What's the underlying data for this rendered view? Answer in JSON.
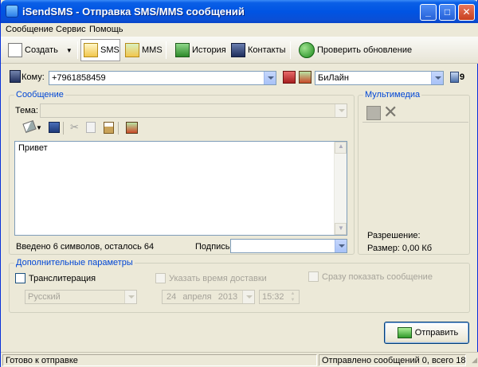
{
  "window": {
    "title": "iSendSMS - Отправка SMS/MMS сообщений"
  },
  "menu": {
    "items": [
      "Сообщение",
      "Сервис",
      "Помощь"
    ]
  },
  "toolbar": {
    "create": "Создать",
    "sms": "SMS",
    "mms": "MMS",
    "history": "История",
    "contacts": "Контакты",
    "update": "Проверить обновление"
  },
  "recipient": {
    "label": "Кому:",
    "value": "+7961858459",
    "operator": "БиЛайн",
    "count": "9"
  },
  "message": {
    "group_title": "Сообщение",
    "subject_label": "Тема:",
    "subject_value": "",
    "body": "Привет",
    "counter": "Введено 6 символов, осталось 64",
    "signature_label": "Подпись",
    "signature_value": ""
  },
  "multimedia": {
    "group_title": "Мультимедиа",
    "resolution_label": "Разрешение:",
    "size_label": "Размер: 0,00 Кб"
  },
  "extra": {
    "group_title": "Дополнительные параметры",
    "transliteration": "Транслитерация",
    "language": "Русский",
    "delivery_time": "Указать время доставки",
    "date_day": "24",
    "date_month": "апреля",
    "date_year": "2013",
    "time": "15:32",
    "show_immediately": "Сразу показать сообщение"
  },
  "send_button": "Отправить",
  "status": {
    "left": "Готово к отправке",
    "right": "Отправлено сообщений 0, всего 18"
  },
  "colors": {
    "title_blue": "#0054e3",
    "group_title": "#0046d5",
    "face": "#ece9d8"
  }
}
